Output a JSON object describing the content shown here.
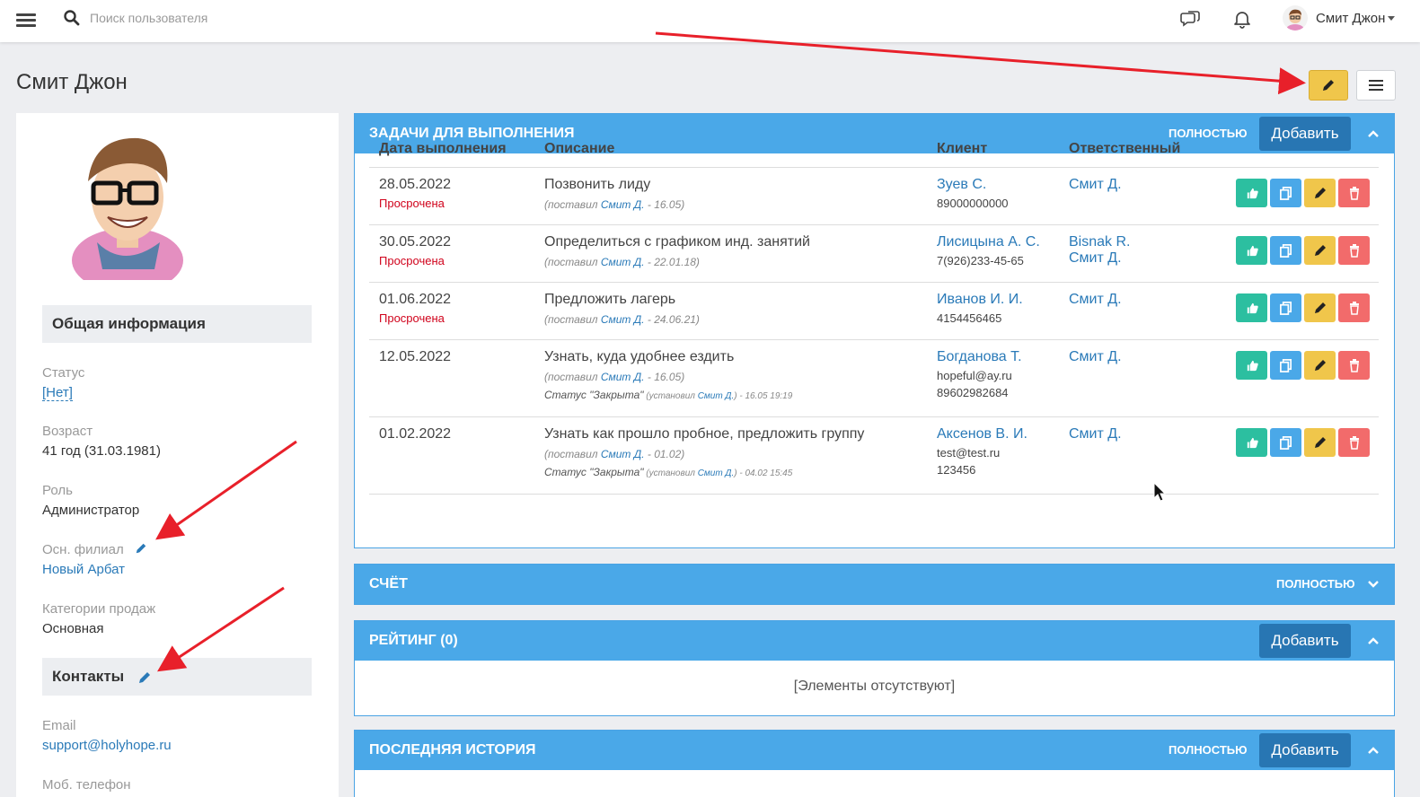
{
  "topbar": {
    "search_placeholder": "Поиск пользователя",
    "user_name": "Смит Джон"
  },
  "page": {
    "title": "Смит Джон"
  },
  "left": {
    "general_header": "Общая информация",
    "fields": [
      {
        "label": "Статус",
        "value": "[Нет]"
      },
      {
        "label": "Возраст",
        "value": "41 год (31.03.1981)"
      },
      {
        "label": "Роль",
        "value": "Администратор"
      },
      {
        "label": "Осн. филиал",
        "value": "Новый Арбат"
      },
      {
        "label": "Категории продаж",
        "value": "Основная"
      }
    ],
    "contacts_header": "Контакты",
    "contacts": [
      {
        "label": "Email",
        "value": "support@holyhope.ru"
      },
      {
        "label": "Моб. телефон"
      }
    ]
  },
  "tasks_panel": {
    "title": "ЗАДАЧИ ДЛЯ ВЫПОЛНЕНИЯ",
    "full_label": "ПОЛНОСТЬЮ",
    "add_label": "Добавить",
    "columns": [
      "Дата выполнения",
      "Описание",
      "Клиент",
      "Ответственный"
    ],
    "rows": [
      {
        "date": "28.05.2022",
        "overdue": "Просрочена",
        "desc": "Позвонить лиду",
        "set_prefix": "(поставил ",
        "set_by": "Смит Д.",
        "set_suffix": " - 16.05)",
        "client": "Зуев С.",
        "client_info": [
          "89000000000"
        ],
        "resp": [
          "Смит Д."
        ]
      },
      {
        "date": "30.05.2022",
        "overdue": "Просрочена",
        "desc": "Определиться с графиком инд. занятий",
        "set_prefix": "(поставил ",
        "set_by": "Смит Д.",
        "set_suffix": " - 22.01.18)",
        "client": "Лисицына А. С.",
        "client_info": [
          "7(926)233-45-65"
        ],
        "resp": [
          "Bisnak R.",
          "Смит Д."
        ]
      },
      {
        "date": "01.06.2022",
        "overdue": "Просрочена",
        "desc": "Предложить лагерь",
        "set_prefix": "(поставил ",
        "set_by": "Смит Д.",
        "set_suffix": " - 24.06.21)",
        "client": "Иванов И. И.",
        "client_info": [
          "4154456465"
        ],
        "resp": [
          "Смит Д."
        ]
      },
      {
        "date": "12.05.2022",
        "overdue": "",
        "desc": "Узнать, куда удобнее ездить",
        "set_prefix": "(поставил ",
        "set_by": "Смит Д.",
        "set_suffix": " - 16.05)",
        "status": "Статус \"Закрыта\"",
        "status_prefix": " (установил ",
        "status_by": "Смит Д.",
        "status_suffix": ") - 16.05 19:19",
        "client": "Богданова Т.",
        "client_info": [
          "hopeful@ay.ru",
          "89602982684"
        ],
        "resp": [
          "Смит Д."
        ]
      },
      {
        "date": "01.02.2022",
        "overdue": "",
        "desc": "Узнать как прошло пробное, предложить группу",
        "set_prefix": "(поставил ",
        "set_by": "Смит Д.",
        "set_suffix": " - 01.02)",
        "status": "Статус \"Закрыта\"",
        "status_prefix": " (установил ",
        "status_by": "Смит Д.",
        "status_suffix": ") - 04.02 15:45",
        "client": "Аксенов В. И.",
        "client_info": [
          "test@test.ru",
          "123456"
        ],
        "resp": [
          "Смит Д."
        ]
      }
    ]
  },
  "invoice_panel": {
    "title": "СЧЁТ",
    "full_label": "ПОЛНОСТЬЮ"
  },
  "rating_panel": {
    "title": "РЕЙТИНГ (0)",
    "add_label": "Добавить",
    "empty": "[Элементы отсутствуют]"
  },
  "history_panel": {
    "title": "ПОСЛЕДНЯЯ ИСТОРИЯ",
    "full_label": "ПОЛНОСТЬЮ",
    "add_label": "Добавить"
  },
  "colors": {
    "accent": "#4aa8e8",
    "button_dark": "#2876b3",
    "ok": "#2cbfa0",
    "edit": "#f0c64b",
    "delete": "#f26b6b",
    "overdue": "#d0021b",
    "arrow": "#e8202a"
  }
}
